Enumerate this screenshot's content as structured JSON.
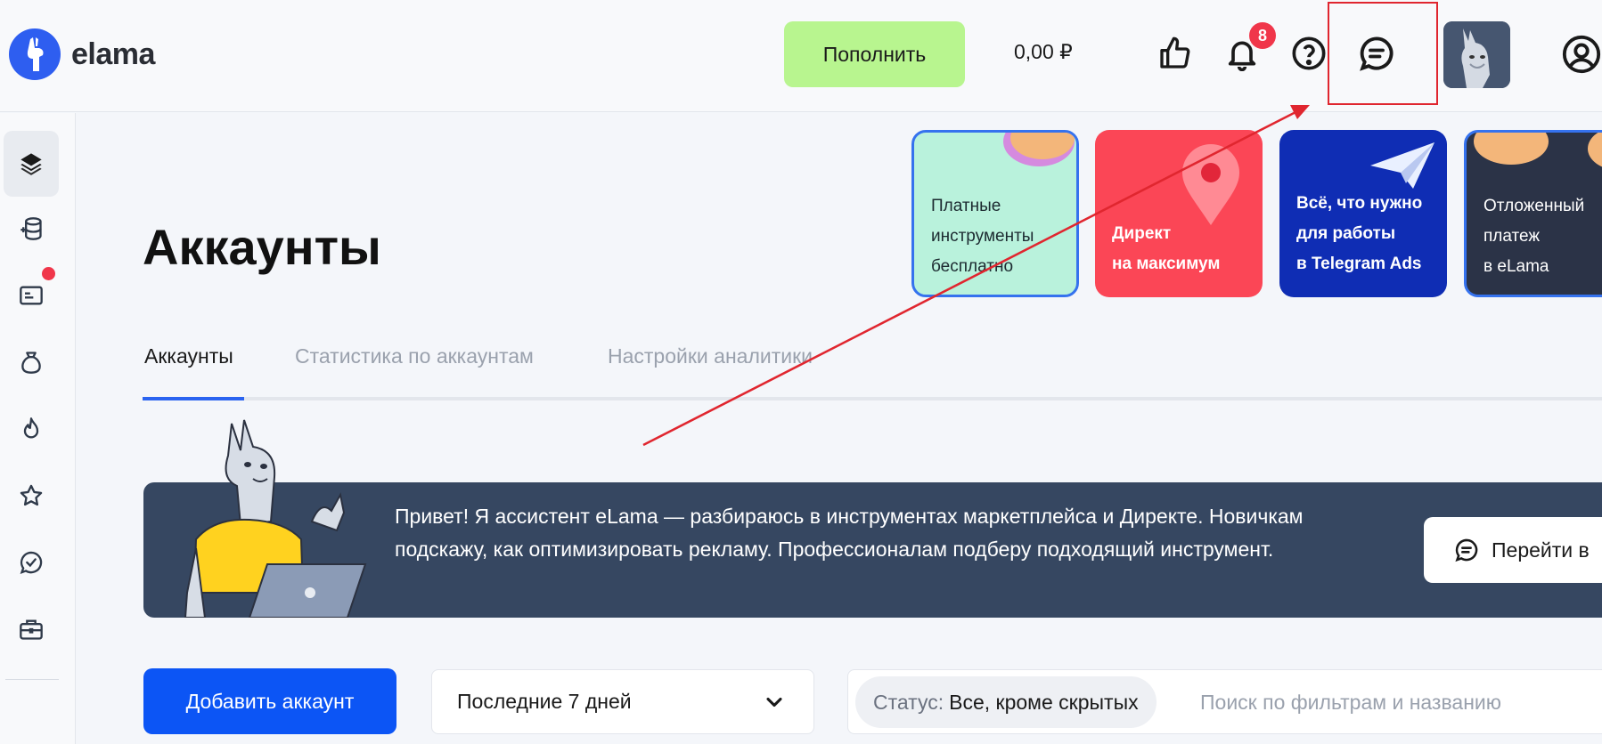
{
  "header": {
    "logo_text": "elama",
    "topup_label": "Пополнить",
    "balance": "0,00 ₽",
    "notifications_count": "8",
    "icons": [
      "like-icon",
      "bell-icon",
      "help-icon",
      "chat-icon",
      "avatar",
      "profile-icon"
    ]
  },
  "sidebar": {
    "items": [
      "layers-icon",
      "database-icon",
      "card-icon",
      "money-bag-icon",
      "fire-icon",
      "star-icon",
      "check-circle-icon",
      "briefcase-icon"
    ]
  },
  "page": {
    "title": "Аккаунты"
  },
  "promo_cards": [
    {
      "lines": [
        "Платные",
        "инструменты",
        "бесплатно"
      ]
    },
    {
      "lines": [
        "Директ",
        "на максимум"
      ]
    },
    {
      "lines": [
        "Всё, что нужно",
        "для работы",
        "в Telegram Ads"
      ]
    },
    {
      "lines": [
        "Отложенный",
        "платеж",
        "в eLama"
      ]
    }
  ],
  "tabs": [
    {
      "label": "Аккаунты",
      "active": true
    },
    {
      "label": "Статистика по аккаунтам",
      "active": false
    },
    {
      "label": "Настройки аналитики",
      "active": false
    }
  ],
  "banner": {
    "text": "Привет! Я ассистент eLama — разбираюсь в инструментах маркетплейса и Директе. Новичкам подскажу, как оптимизировать рекламу. Профессионалам подберу подходящий инструмент.",
    "button_label": "Перейти в"
  },
  "controls": {
    "add_account_label": "Добавить аккаунт",
    "period_value": "Последние 7 дней",
    "status_label": "Статус:",
    "status_value": "Все, кроме скрытых",
    "search_placeholder": "Поиск по фильтрам и названию"
  },
  "colors": {
    "accent": "#0c55f5",
    "topup": "#b8f58f",
    "banner": "#364761",
    "badge": "#f0364a",
    "annotation": "#e0262f"
  }
}
